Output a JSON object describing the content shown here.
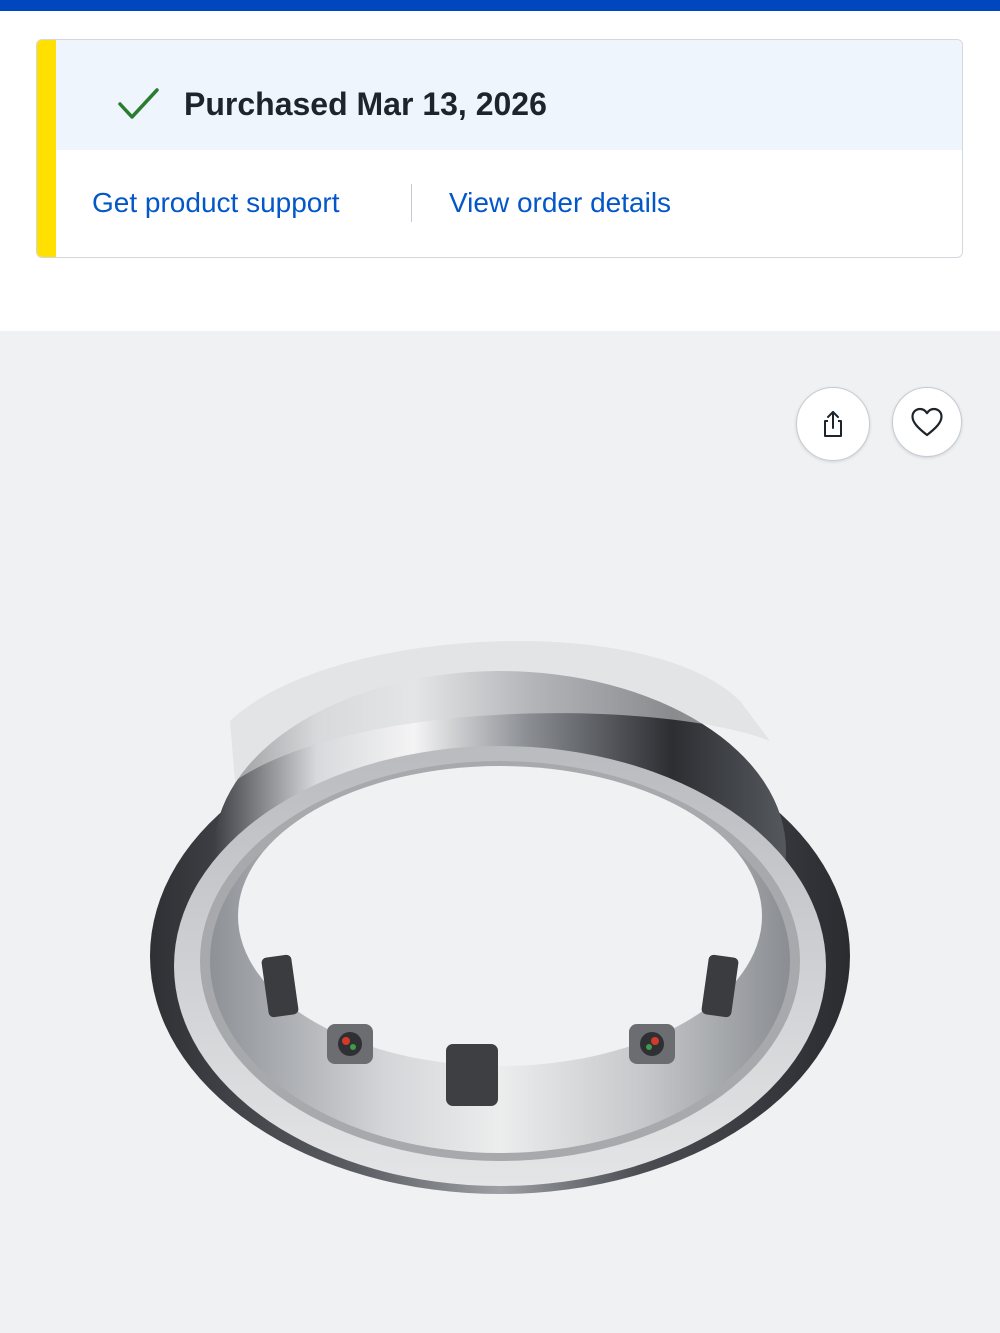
{
  "purchase": {
    "title": "Purchased Mar 13, 2026",
    "status_color": "#2a7d2e",
    "accent_color": "#ffe000"
  },
  "links": {
    "support": "Get product support",
    "order": "View order details"
  },
  "actions": {
    "share_icon": "share-icon",
    "favorite_icon": "heart-icon"
  },
  "brand": {
    "top_bar_color": "#0046be",
    "link_color": "#0457c8"
  }
}
